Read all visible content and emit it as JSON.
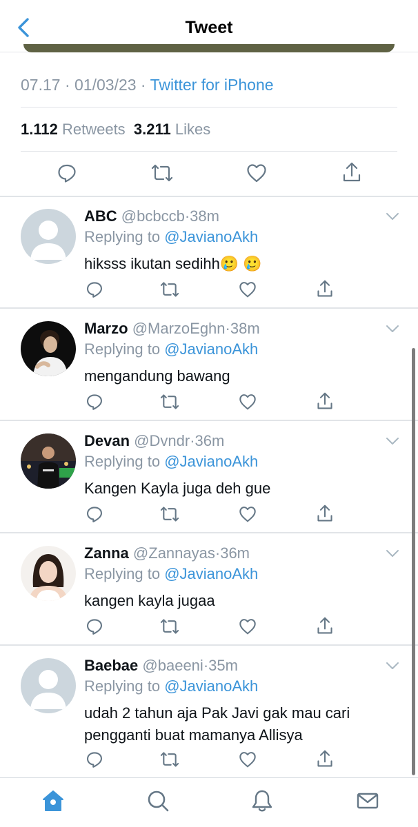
{
  "header": {
    "title": "Tweet",
    "back_icon": "chevron-left-icon"
  },
  "tweet": {
    "time": "07.17",
    "date": "01/03/23",
    "source": "Twitter for iPhone",
    "retweets_count": "1.112",
    "retweets_label": "Retweets",
    "likes_count": "3.211",
    "likes_label": "Likes",
    "actions": [
      "reply-icon",
      "retweet-icon",
      "like-icon",
      "share-icon"
    ]
  },
  "replying_label": "Replying to",
  "replies": [
    {
      "name": "ABC",
      "handle": "@bcbccb",
      "time": "38m",
      "replying_to": "@JavianoAkh",
      "text": "hiksss ikutan sedihh🥲 🥲"
    },
    {
      "name": "Marzo",
      "handle": "@MarzoEghn",
      "time": "38m",
      "replying_to": "@JavianoAkh",
      "text": "mengandung bawang"
    },
    {
      "name": "Devan",
      "handle": "@Dvndr",
      "time": "36m",
      "replying_to": "@JavianoAkh",
      "text": "Kangen Kayla juga deh gue"
    },
    {
      "name": "Zanna",
      "handle": "@Zannayas",
      "time": "36m",
      "replying_to": "@JavianoAkh",
      "text": "kangen kayla jugaa"
    },
    {
      "name": "Baebae",
      "handle": "@baeeni",
      "time": "35m",
      "replying_to": "@JavianoAkh",
      "text": "udah 2 tahun aja Pak Javi gak mau cari pengganti buat mamanya Allisya"
    }
  ],
  "tabbar": {
    "items": [
      "home-icon",
      "search-icon",
      "notifications-icon",
      "messages-icon"
    ],
    "active": "home-icon"
  },
  "colors": {
    "accent": "#3b94d9",
    "muted": "#8a96a3",
    "text": "#0f1419",
    "divider": "#e1e4e8"
  }
}
